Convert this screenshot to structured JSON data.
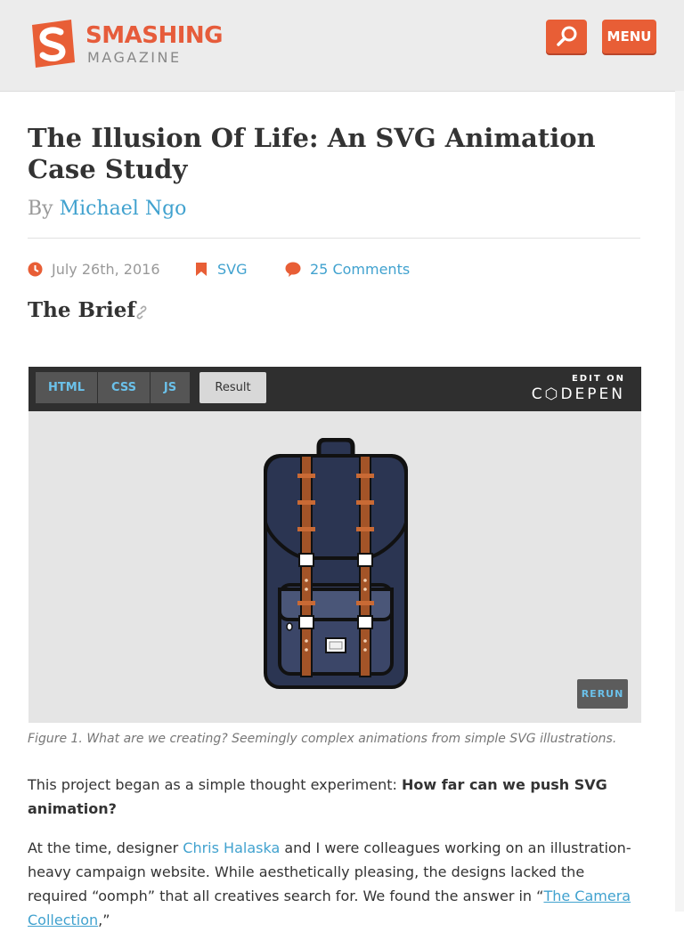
{
  "brand": {
    "name_line1": "SMASHING",
    "name_line2": "MAGAZINE",
    "accent_color": "#e85e36"
  },
  "header": {
    "search_icon": "search-icon",
    "menu_label": "MENU"
  },
  "article": {
    "title": "The Illusion Of Life: An SVG Animation Case Study",
    "by_prefix": "By",
    "author": "Michael Ngo",
    "date": "July 26th, 2016",
    "tag": "SVG",
    "comments": "25 Comments",
    "section_heading": "The Brief"
  },
  "codepen": {
    "tabs": [
      "HTML",
      "CSS",
      "JS",
      "Result"
    ],
    "active_tab": "Result",
    "edit_on": "EDIT ON",
    "name": "C⬡DEPEN",
    "rerun": "RERUN"
  },
  "figure_caption": "Figure 1. What are we creating? Seemingly complex animations from simple SVG illustrations.",
  "paragraphs": {
    "p1_text": "This project began as a simple thought experiment: ",
    "p1_bold": "How far can we push SVG animation?",
    "p2_a": "At the time, designer ",
    "p2_link1": "Chris Halaska",
    "p2_b": " and I were colleagues working on an illustration-heavy campaign website. While aesthetically pleasing, the designs lacked the required “oomph” that all creatives search for. We found the answer in “",
    "p2_link2": "The Camera Collection",
    "p2_c": ",”"
  }
}
